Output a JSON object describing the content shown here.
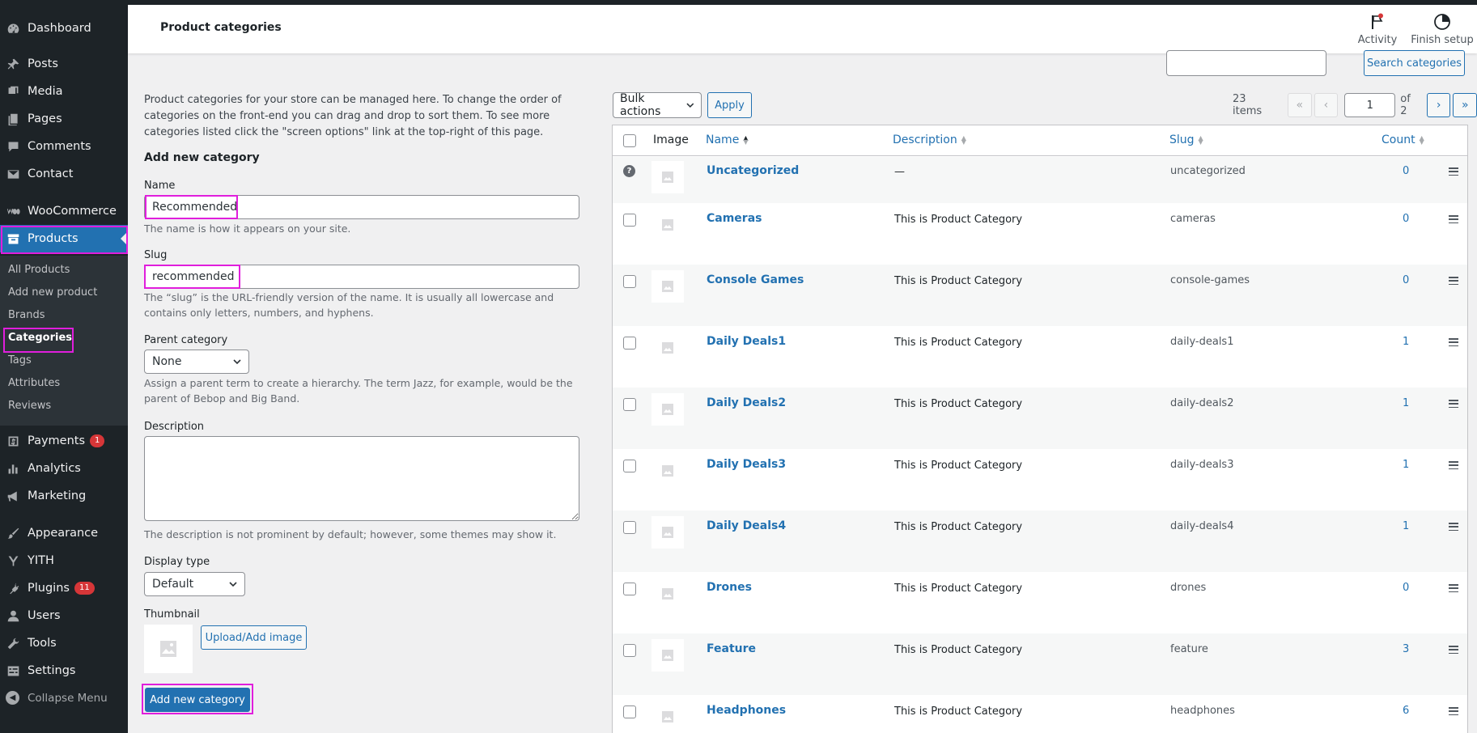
{
  "sidebar": {
    "items": [
      {
        "label": "Dashboard",
        "icon": "dashboard-icon"
      },
      {
        "label": "Posts",
        "icon": "pin-icon"
      },
      {
        "label": "Media",
        "icon": "media-icon"
      },
      {
        "label": "Pages",
        "icon": "pages-icon"
      },
      {
        "label": "Comments",
        "icon": "comment-icon"
      },
      {
        "label": "Contact",
        "icon": "mail-icon"
      },
      {
        "label": "WooCommerce",
        "icon": "woo-icon"
      },
      {
        "label": "Products",
        "icon": "archive-icon"
      },
      {
        "label": "Payments",
        "icon": "dollar-icon",
        "badge": "1"
      },
      {
        "label": "Analytics",
        "icon": "bar-chart-icon"
      },
      {
        "label": "Marketing",
        "icon": "megaphone-icon"
      },
      {
        "label": "Appearance",
        "icon": "brush-icon"
      },
      {
        "label": "YITH",
        "icon": "yith-icon"
      },
      {
        "label": "Plugins",
        "icon": "plug-icon",
        "badge": "11"
      },
      {
        "label": "Users",
        "icon": "user-icon"
      },
      {
        "label": "Tools",
        "icon": "wrench-icon"
      },
      {
        "label": "Settings",
        "icon": "settings-icon"
      }
    ],
    "submenu": [
      "All Products",
      "Add new product",
      "Brands",
      "Categories",
      "Tags",
      "Attributes",
      "Reviews"
    ],
    "collapse_label": "Collapse Menu"
  },
  "header": {
    "title": "Product categories",
    "activity_label": "Activity",
    "finish_setup_label": "Finish setup"
  },
  "search": {
    "button_label": "Search categories",
    "value": ""
  },
  "form": {
    "intro": "Product categories for your store can be managed here. To change the order of categories on the front-end you can drag and drop to sort them. To see more categories listed click the \"screen options\" link at the top-right of this page.",
    "heading": "Add new category",
    "name_label": "Name",
    "name_value": "Recommended",
    "name_help": "The name is how it appears on your site.",
    "slug_label": "Slug",
    "slug_value": "recommended",
    "slug_help": "The “slug” is the URL-friendly version of the name. It is usually all lowercase and contains only letters, numbers, and hyphens.",
    "parent_label": "Parent category",
    "parent_value": "None",
    "parent_help": "Assign a parent term to create a hierarchy. The term Jazz, for example, would be the parent of Bebop and Big Band.",
    "description_label": "Description",
    "description_help": "The description is not prominent by default; however, some themes may show it.",
    "display_type_label": "Display type",
    "display_type_value": "Default",
    "thumbnail_label": "Thumbnail",
    "upload_label": "Upload/Add image",
    "submit_label": "Add new category"
  },
  "tablenav": {
    "bulk_actions": "Bulk actions",
    "apply_label": "Apply",
    "items_count": "23 items",
    "current_page": "1",
    "of_pages": "of 2",
    "first": "«",
    "prev": "‹",
    "next": "›",
    "last": "»"
  },
  "table": {
    "columns": {
      "image": "Image",
      "name": "Name",
      "description": "Description",
      "slug": "Slug",
      "count": "Count"
    },
    "rows": [
      {
        "name": "Uncategorized",
        "description": "—",
        "slug": "uncategorized",
        "count": "0"
      },
      {
        "name": "Cameras",
        "description": "This is Product Category",
        "slug": "cameras",
        "count": "0"
      },
      {
        "name": "Console Games",
        "description": "This is Product Category",
        "slug": "console-games",
        "count": "0"
      },
      {
        "name": "Daily Deals1",
        "description": "This is Product Category",
        "slug": "daily-deals1",
        "count": "1"
      },
      {
        "name": "Daily Deals2",
        "description": "This is Product Category",
        "slug": "daily-deals2",
        "count": "1"
      },
      {
        "name": "Daily Deals3",
        "description": "This is Product Category",
        "slug": "daily-deals3",
        "count": "1"
      },
      {
        "name": "Daily Deals4",
        "description": "This is Product Category",
        "slug": "daily-deals4",
        "count": "1"
      },
      {
        "name": "Drones",
        "description": "This is Product Category",
        "slug": "drones",
        "count": "0"
      },
      {
        "name": "Feature",
        "description": "This is Product Category",
        "slug": "feature",
        "count": "3"
      },
      {
        "name": "Headphones",
        "description": "This is Product Category",
        "slug": "headphones",
        "count": "6"
      }
    ]
  },
  "colors": {
    "accent": "#2271b1",
    "sidebar_bg": "#1d2327",
    "highlight": "#e01edc",
    "badge": "#d63638"
  }
}
